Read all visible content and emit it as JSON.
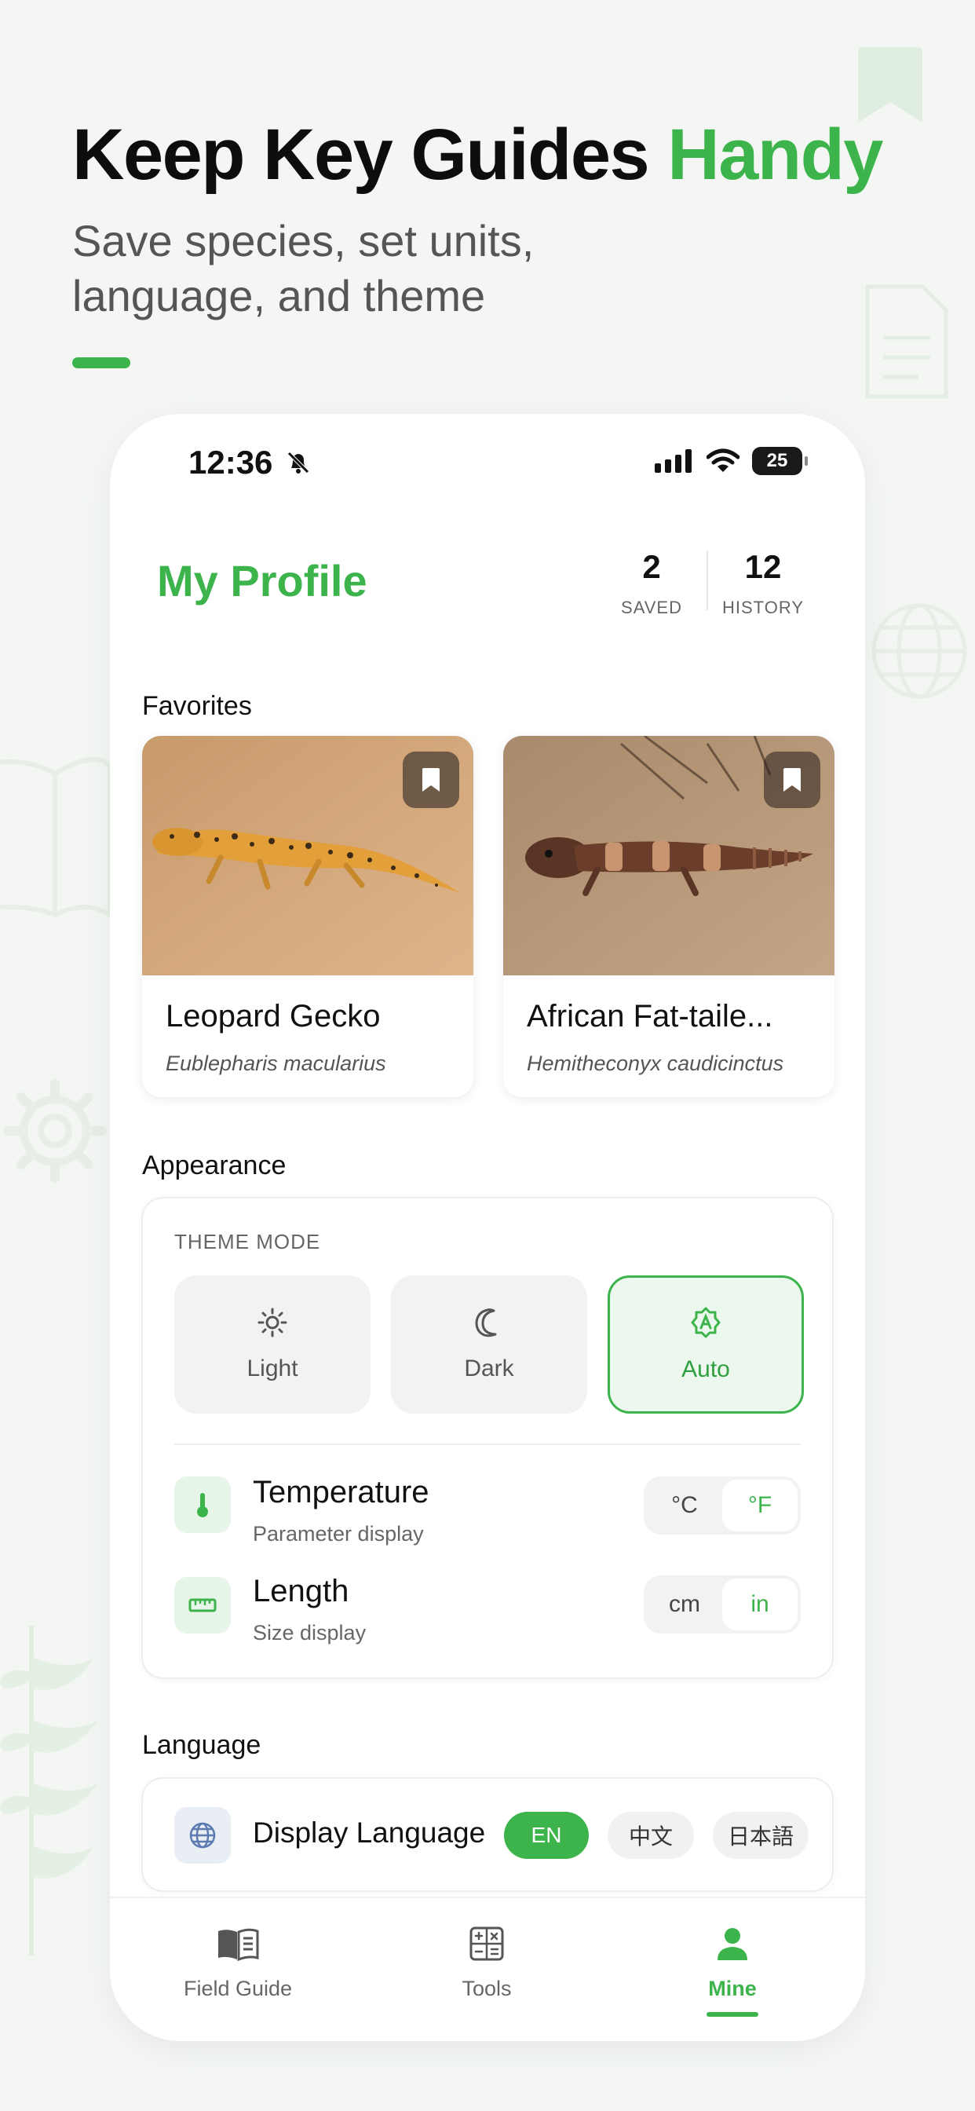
{
  "promo": {
    "headline_main": "Keep Key Guides",
    "headline_accent": "Handy",
    "subline": "Save species, set units, language, and theme"
  },
  "status_bar": {
    "time": "12:36",
    "battery": "25"
  },
  "profile": {
    "title": "My Profile",
    "stats": [
      {
        "value": "2",
        "label": "SAVED"
      },
      {
        "value": "12",
        "label": "HISTORY"
      }
    ]
  },
  "favorites": {
    "heading": "Favorites",
    "items": [
      {
        "name": "Leopard Gecko",
        "scientific": "Eublepharis macularius"
      },
      {
        "name": "African Fat-taile...",
        "scientific": "Hemitheconyx caudicinctus"
      }
    ]
  },
  "appearance": {
    "heading": "Appearance",
    "theme_heading": "THEME MODE",
    "theme_options": [
      {
        "label": "Light",
        "icon": "sun-icon"
      },
      {
        "label": "Dark",
        "icon": "moon-icon"
      },
      {
        "label": "Auto",
        "icon": "auto-theme-icon"
      }
    ],
    "theme_selected": "Auto",
    "temperature": {
      "title": "Temperature",
      "subtitle": "Parameter display",
      "options": [
        "°C",
        "°F"
      ],
      "selected": "°F"
    },
    "length": {
      "title": "Length",
      "subtitle": "Size display",
      "options": [
        "cm",
        "in"
      ],
      "selected": "in"
    }
  },
  "language": {
    "heading": "Language",
    "title": "Display Language",
    "options": [
      "EN",
      "中文",
      "日本語"
    ],
    "selected": "EN"
  },
  "tabbar": {
    "tabs": [
      {
        "label": "Field Guide",
        "icon": "book-icon"
      },
      {
        "label": "Tools",
        "icon": "calculator-icon"
      },
      {
        "label": "Mine",
        "icon": "person-icon"
      }
    ],
    "active": "Mine"
  },
  "colors": {
    "accent": "#3cb44b",
    "accent_light": "#ecf8ed"
  }
}
